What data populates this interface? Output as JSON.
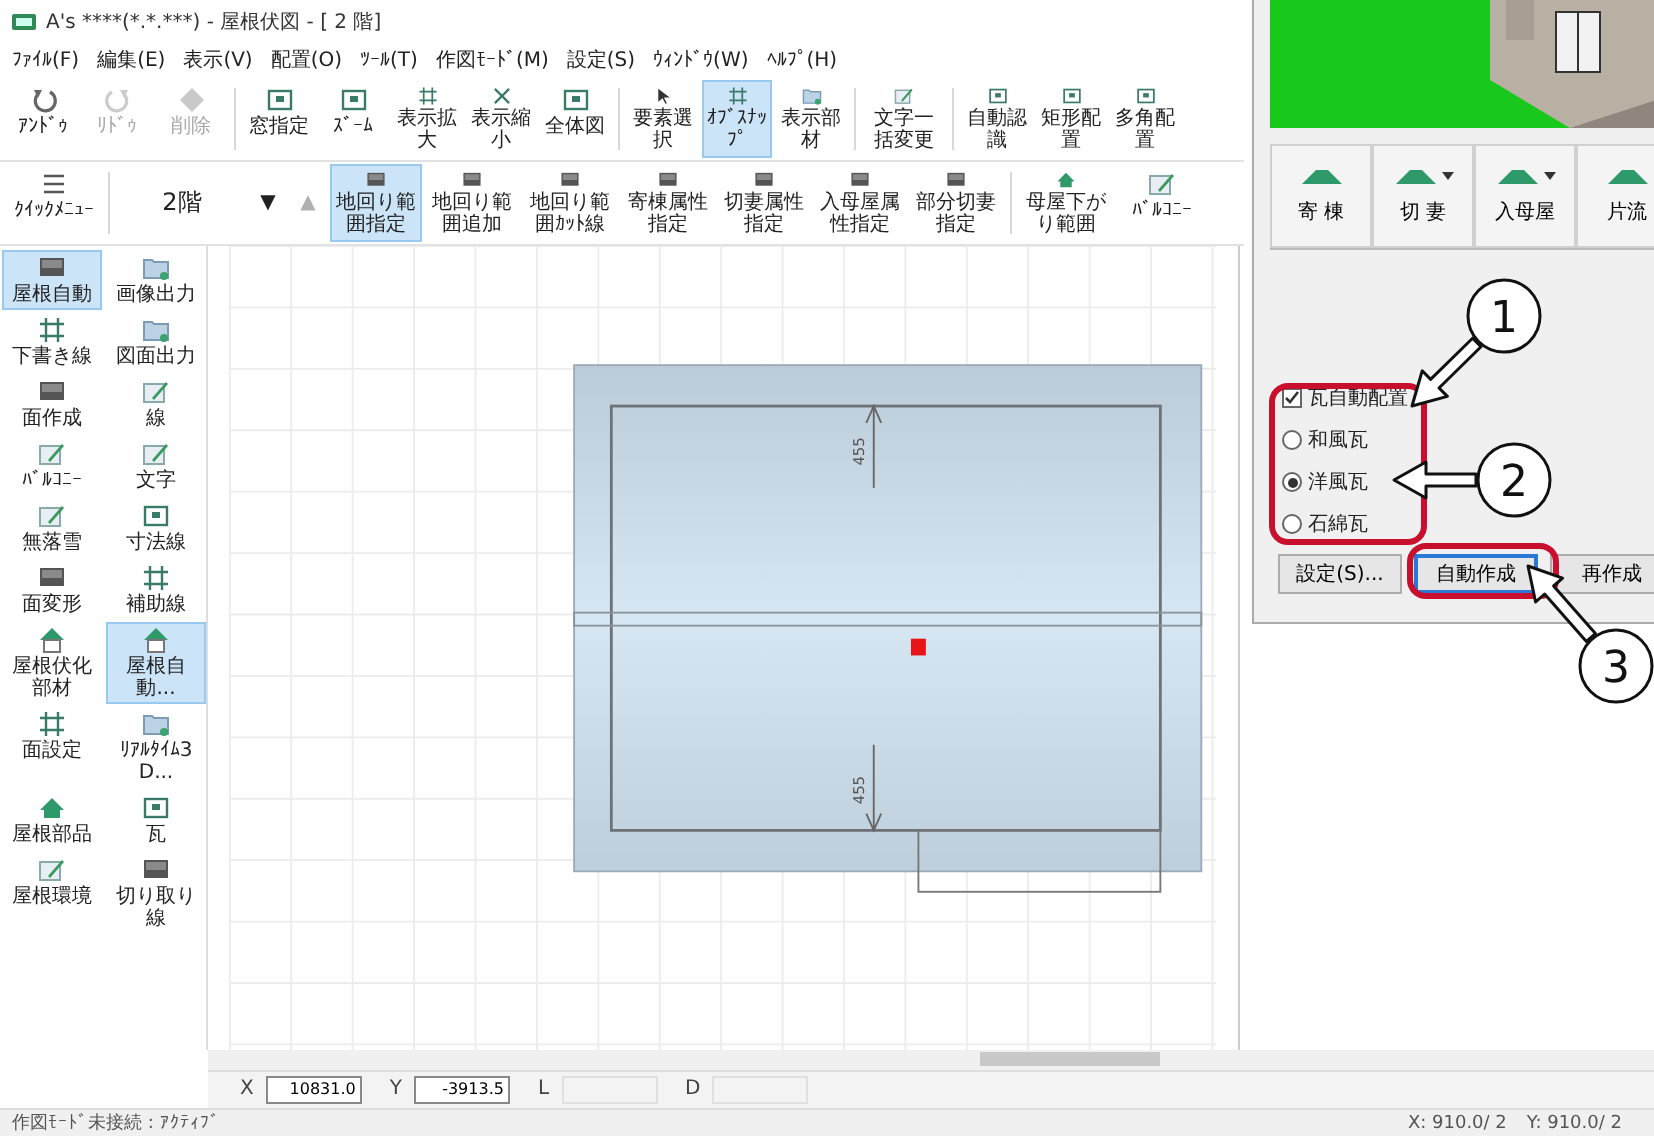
{
  "window": {
    "title": "A's ****(*.*.***) - 屋根伏図 - [ 2 階]"
  },
  "menu": [
    "ﾌｧｲﾙ(F)",
    "編集(E)",
    "表示(V)",
    "配置(O)",
    "ﾂｰﾙ(T)",
    "作図ﾓｰﾄﾞ(M)",
    "設定(S)",
    "ｳｨﾝﾄﾞｳ(W)",
    "ﾍﾙﾌﾟ(H)"
  ],
  "toolbar": [
    {
      "label": "ｱﾝﾄﾞｩ",
      "disabled": false,
      "selected": false
    },
    {
      "label": "ﾘﾄﾞｩ",
      "disabled": true,
      "selected": false
    },
    {
      "label": "削除",
      "disabled": true,
      "selected": false
    },
    {
      "label": "窓指定",
      "disabled": false,
      "selected": false
    },
    {
      "label": "ｽﾞｰﾑ",
      "disabled": false,
      "selected": false
    },
    {
      "label": "表示拡大",
      "disabled": false,
      "selected": false
    },
    {
      "label": "表示縮小",
      "disabled": false,
      "selected": false
    },
    {
      "label": "全体図",
      "disabled": false,
      "selected": false
    },
    {
      "label": "要素選択",
      "disabled": false,
      "selected": false
    },
    {
      "label": "ｵﾌﾞｽﾅｯﾌﾟ",
      "disabled": false,
      "selected": true
    },
    {
      "label": "表示部材",
      "disabled": false,
      "selected": false
    },
    {
      "label": "文字一括変更",
      "disabled": false,
      "selected": false
    },
    {
      "label": "自動認識",
      "disabled": false,
      "selected": false
    },
    {
      "label": "矩形配置",
      "disabled": false,
      "selected": false
    },
    {
      "label": "多角配置",
      "disabled": false,
      "selected": false
    }
  ],
  "quick_menu": {
    "label": "ｸｲｯｸﾒﾆｭｰ"
  },
  "floor": {
    "value": "2階"
  },
  "floor_buttons": [
    {
      "label": "▼",
      "disabled": false
    },
    {
      "label": "▲",
      "disabled": true
    }
  ],
  "range_tools": [
    {
      "label": "地回り範囲指定",
      "selected": true
    },
    {
      "label": "地回り範囲追加",
      "selected": false
    },
    {
      "label": "地回り範囲ｶｯﾄ線",
      "selected": false
    },
    {
      "label": "寄棟属性指定",
      "selected": false
    },
    {
      "label": "切妻属性指定",
      "selected": false
    },
    {
      "label": "入母屋属性指定",
      "selected": false
    },
    {
      "label": "部分切妻指定",
      "selected": false
    },
    {
      "label": "母屋下がり範囲",
      "selected": false
    },
    {
      "label": "ﾊﾞﾙｺﾆｰ",
      "selected": false
    }
  ],
  "sidebar": {
    "items": [
      {
        "label": "屋根自動",
        "selected": true
      },
      {
        "label": "画像出力",
        "selected": false
      },
      {
        "label": "下書き線",
        "selected": false
      },
      {
        "label": "図面出力",
        "selected": false
      },
      {
        "label": "面作成",
        "selected": false
      },
      {
        "label": "線",
        "selected": false
      },
      {
        "label": "ﾊﾞﾙｺﾆｰ",
        "selected": false
      },
      {
        "label": "文字",
        "selected": false
      },
      {
        "label": "無落雪",
        "selected": false
      },
      {
        "label": "寸法線",
        "selected": false
      },
      {
        "label": "面変形",
        "selected": false
      },
      {
        "label": "補助線",
        "selected": false
      },
      {
        "label": "屋根伏化部材",
        "selected": false
      },
      {
        "label": "屋根自動...",
        "selected": true
      },
      {
        "label": "面設定",
        "selected": false
      },
      {
        "label": "ﾘｱﾙﾀｲﾑ3D...",
        "selected": false
      },
      {
        "label": "屋根部品",
        "selected": false
      },
      {
        "label": "瓦",
        "selected": false
      },
      {
        "label": "屋根環境",
        "selected": false
      },
      {
        "label": "切り取り線",
        "selected": false
      }
    ]
  },
  "canvas": {
    "dimension_labels": [
      "455",
      "455"
    ]
  },
  "coordinates": [
    {
      "label": "X",
      "value": "10831.0"
    },
    {
      "label": "Y",
      "value": "-3913.5"
    },
    {
      "label": "L"
    },
    {
      "label": "D"
    }
  ],
  "status_bar": {
    "message": "作図ﾓｰﾄﾞ未接続 : ｱｸﾃｨﾌﾞ",
    "readouts": [
      "X: 910.0/ 2",
      "Y: 910.0/ 2"
    ]
  },
  "dialog": {
    "roof_types": [
      {
        "label": "寄 棟",
        "dropdown": false
      },
      {
        "label": "切 妻",
        "dropdown": true
      },
      {
        "label": "入母屋",
        "dropdown": true
      },
      {
        "label": "片流",
        "dropdown": false
      }
    ],
    "auto_tile": {
      "label": "瓦自動配置",
      "checked": true
    },
    "tile_types": [
      {
        "label": "和風瓦",
        "selected": false
      },
      {
        "label": "洋風瓦",
        "selected": true
      },
      {
        "label": "石綿瓦",
        "selected": false
      }
    ],
    "buttons": [
      {
        "label": "設定(S)...",
        "focused": false
      },
      {
        "label": "自動作成",
        "focused": true
      },
      {
        "label": "再作成",
        "focused": false
      }
    ]
  },
  "callouts": [
    "1",
    "2",
    "3"
  ]
}
